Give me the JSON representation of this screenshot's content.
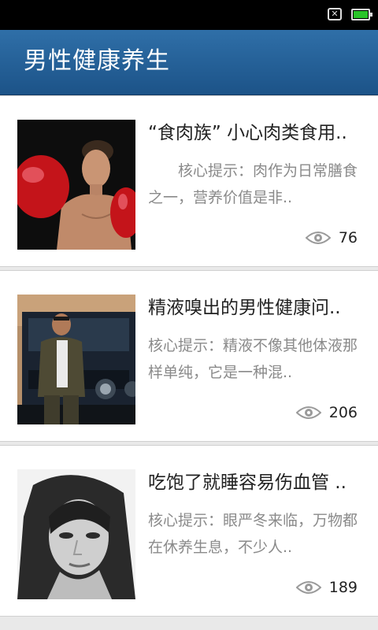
{
  "app": {
    "title": "男性健康养生"
  },
  "articles": [
    {
      "title": "“食肉族” 小心肉类食用..",
      "description": "　　核心提示：肉作为日常膳食之一，营养价值是非..",
      "views": "76",
      "thumbnail": "man-with-boxing-gloves-photo"
    },
    {
      "title": "精液嗅出的男性健康问..",
      "description": "核心提示：精液不像其他体液那样单纯，它是一种混..",
      "views": "206",
      "thumbnail": "man-with-jeep-photo"
    },
    {
      "title": "吃饱了就睡容易伤血管 ..",
      "description": "核心提示：眼严冬来临，万物都在休养生息，不少人..",
      "views": "189",
      "thumbnail": "woman-portrait-photo"
    }
  ],
  "colors": {
    "header_bg": "#1f5a92",
    "title_text": "#222222",
    "desc_text": "#8a8a8a"
  }
}
